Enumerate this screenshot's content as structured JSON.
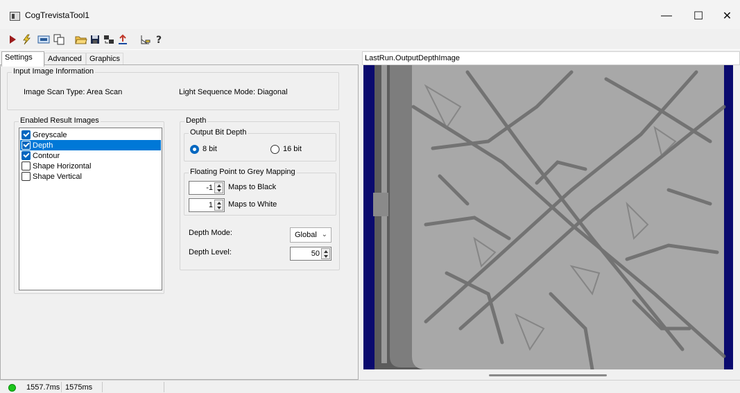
{
  "window": {
    "title": "CogTrevistaTool1",
    "controls": [
      "—",
      "☐",
      "✕"
    ]
  },
  "toolbar": {
    "icons": [
      "run-icon",
      "flash-icon",
      "display-icon",
      "copy-icon",
      "open-icon",
      "save-icon",
      "import-icon",
      "reset-icon",
      "properties-icon",
      "help-icon"
    ]
  },
  "tabs": [
    {
      "label": "Settings",
      "active": true
    },
    {
      "label": "Advanced",
      "active": false
    },
    {
      "label": "Graphics",
      "active": false
    }
  ],
  "input_image_info": {
    "title": "Input Image Information",
    "scan_type": "Image Scan Type: Area Scan",
    "light_sequence": "Light Sequence Mode: Diagonal"
  },
  "enabled_results": {
    "title": "Enabled Result Images",
    "items": [
      {
        "label": "Greyscale",
        "checked": true,
        "selected": false
      },
      {
        "label": "Depth",
        "checked": true,
        "selected": true
      },
      {
        "label": "Contour",
        "checked": true,
        "selected": false
      },
      {
        "label": "Shape Horizontal",
        "checked": false,
        "selected": false
      },
      {
        "label": "Shape Vertical",
        "checked": false,
        "selected": false
      }
    ]
  },
  "depth": {
    "title": "Depth",
    "bit_depth": {
      "title": "Output Bit Depth",
      "option_8": "8 bit",
      "option_16": "16 bit",
      "selected": "8 bit"
    },
    "mapping": {
      "title": "Floating Point to Grey Mapping",
      "black_value": "-1",
      "black_label": "Maps to Black",
      "white_value": "1",
      "white_label": "Maps to White"
    },
    "mode_label": "Depth Mode:",
    "mode_value": "Global",
    "level_label": "Depth Level:",
    "level_value": "50"
  },
  "image_view": {
    "selector": "LastRun.OutputDepthImage"
  },
  "status": {
    "time1": "1557.7ms",
    "time2": "1575ms",
    "led_color": "#1bc61b"
  }
}
